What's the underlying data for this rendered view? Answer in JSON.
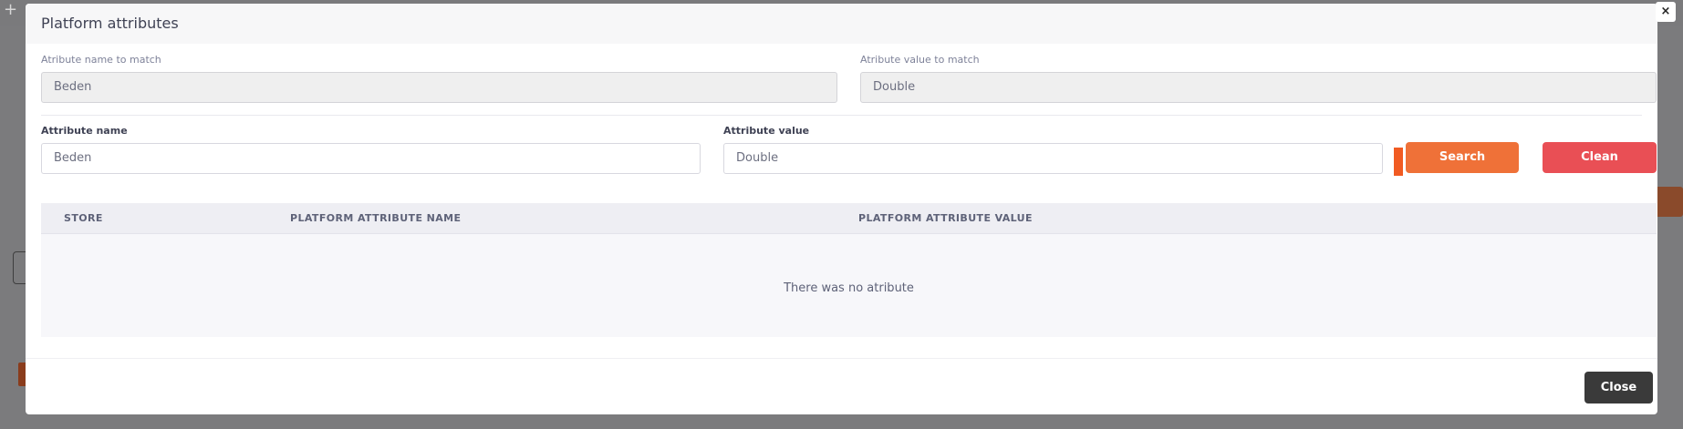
{
  "modal": {
    "title": "Platform attributes",
    "name_to_match_label": "Atribute name to match",
    "name_to_match_value": "Beden",
    "value_to_match_label": "Atribute value to match",
    "value_to_match_value": "Double",
    "attribute_name_label": "Attribute name",
    "attribute_name_value": "Beden",
    "attribute_value_label": "Attribute value",
    "attribute_value_value": "Double",
    "search_label": "Search",
    "clean_label": "Clean",
    "table": {
      "columns": [
        "STORE",
        "PLATFORM ATTRIBUTE NAME",
        "PLATFORM ATTRIBUTE VALUE"
      ],
      "empty_message": "There was no atribute"
    },
    "close_label": "Close",
    "x_glyph": "×"
  },
  "colors": {
    "search_button": "#ef7138",
    "clean_button": "#e94f55",
    "close_button": "#3a3a3a",
    "accent_marker": "#f15b22"
  },
  "icons": [
    "close-icon",
    "plus-icon"
  ]
}
